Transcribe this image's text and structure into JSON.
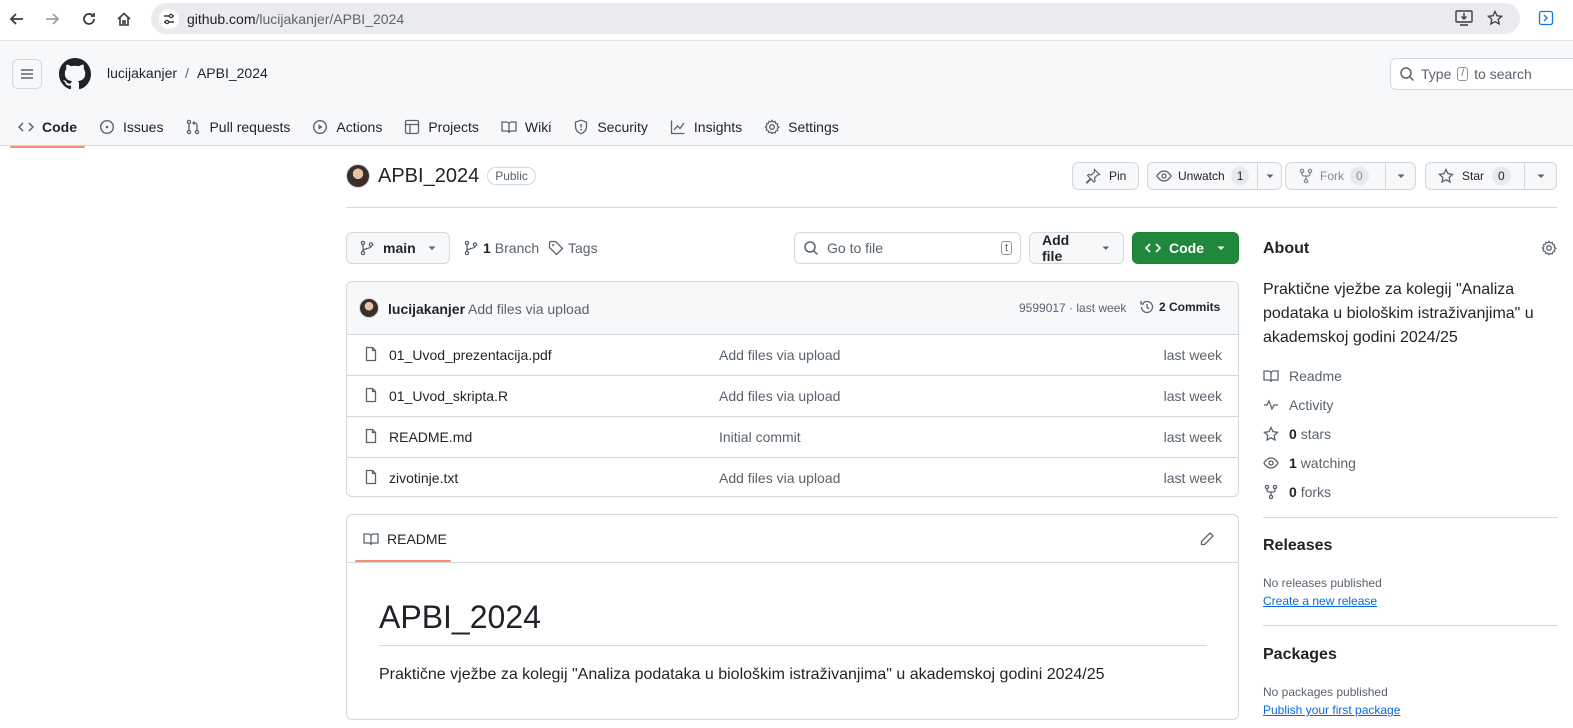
{
  "browser": {
    "url_host": "github.com",
    "url_path": "/lucijakanjer/APBI_2024"
  },
  "header": {
    "owner": "lucijakanjer",
    "separator": "/",
    "repo": "APBI_2024",
    "search_prefix": "Type",
    "search_key": "/",
    "search_suffix": "to search"
  },
  "tabs": [
    {
      "label": "Code",
      "icon": "code-icon"
    },
    {
      "label": "Issues",
      "icon": "issue-icon"
    },
    {
      "label": "Pull requests",
      "icon": "pull-request-icon"
    },
    {
      "label": "Actions",
      "icon": "play-icon"
    },
    {
      "label": "Projects",
      "icon": "table-icon"
    },
    {
      "label": "Wiki",
      "icon": "book-icon"
    },
    {
      "label": "Security",
      "icon": "shield-icon"
    },
    {
      "label": "Insights",
      "icon": "graph-icon"
    },
    {
      "label": "Settings",
      "icon": "gear-icon"
    }
  ],
  "repo": {
    "name": "APBI_2024",
    "visibility": "Public",
    "pin_label": "Pin",
    "unwatch_label": "Unwatch",
    "watch_count": "1",
    "fork_label": "Fork",
    "fork_count": "0",
    "star_label": "Star",
    "star_count": "0"
  },
  "branch_bar": {
    "branch": "main",
    "branch_count": "1",
    "branch_label": "Branch",
    "tags_label": "Tags",
    "goto_placeholder": "Go to file",
    "goto_key": "t",
    "add_file_label": "Add file",
    "code_label": "Code"
  },
  "commit": {
    "author": "lucijakanjer",
    "message": "Add files via upload",
    "hash_time": "9599017 · last week",
    "commits": "2 Commits"
  },
  "files": [
    {
      "name": "01_Uvod_prezentacija.pdf",
      "message": "Add files via upload",
      "date": "last week"
    },
    {
      "name": "01_Uvod_skripta.R",
      "message": "Add files via upload",
      "date": "last week"
    },
    {
      "name": "README.md",
      "message": "Initial commit",
      "date": "last week"
    },
    {
      "name": "zivotinje.txt",
      "message": "Add files via upload",
      "date": "last week"
    }
  ],
  "readme": {
    "tab_label": "README",
    "heading": "APBI_2024",
    "body": "Praktične vježbe za kolegij \"Analiza podataka u biološkim istraživanjima\" u akademskoj godini 2024/25"
  },
  "about": {
    "title": "About",
    "description": "Praktične vježbe za kolegij \"Analiza podataka u biološkim istraživanjima\" u akademskoj godini 2024/25",
    "readme": "Readme",
    "activity": "Activity",
    "stars_count": "0",
    "stars_label": "stars",
    "watching_count": "1",
    "watching_label": "watching",
    "forks_count": "0",
    "forks_label": "forks"
  },
  "releases": {
    "title": "Releases",
    "empty": "No releases published",
    "link": "Create a new release"
  },
  "packages": {
    "title": "Packages",
    "empty": "No packages published",
    "link": "Publish your first package"
  },
  "colors": {
    "accent_tab": "#fd8c73",
    "green_button": "#1f883d",
    "link": "#0969da"
  }
}
